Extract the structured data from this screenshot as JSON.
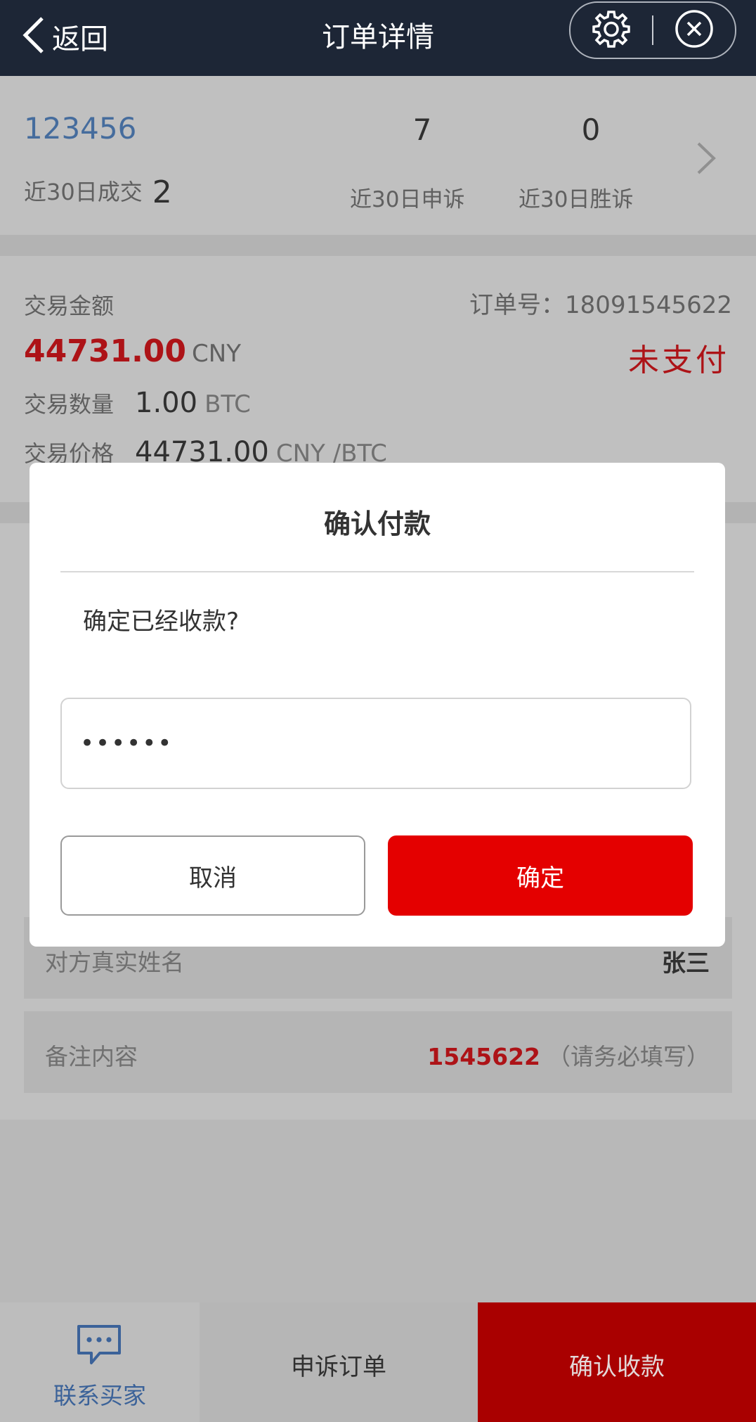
{
  "topbar": {
    "back_label": "返回",
    "title": "订单详情",
    "settings_icon": "gear-icon",
    "close_icon": "close-circle-icon"
  },
  "stats": {
    "user_id": "123456",
    "recent_trades_label": "近30日成交",
    "recent_trades_value": "2",
    "appeals_value": "7",
    "appeals_label": "近30日申诉",
    "wins_value": "0",
    "wins_label": "近30日胜诉"
  },
  "order": {
    "amount_label": "交易金额",
    "order_no": "订单号：18091545622",
    "amount": "44731.00",
    "amount_unit": "CNY",
    "status": "未支付",
    "qty_label": "交易数量",
    "qty_value": "1.00",
    "qty_unit": "BTC",
    "price_label": "交易价格",
    "price_value": "44731.00",
    "price_unit": "CNY /BTC"
  },
  "details": {
    "name_label": "对方真实姓名",
    "name_value": "张三",
    "remark_label": "备注内容",
    "remark_code": "1545622",
    "remark_hint": "（请务必填写）"
  },
  "bottom": {
    "contact_label": "联系买家",
    "appeal_label": "申诉订单",
    "confirm_label": "确认收款"
  },
  "dialog": {
    "title": "确认付款",
    "message": "确定已经收款?",
    "password_value": "••••••",
    "cancel_label": "取消",
    "ok_label": "确定"
  },
  "colors": {
    "nav_bg": "#1d2636",
    "accent_red": "#e40000",
    "link_blue": "#4a73a7"
  }
}
